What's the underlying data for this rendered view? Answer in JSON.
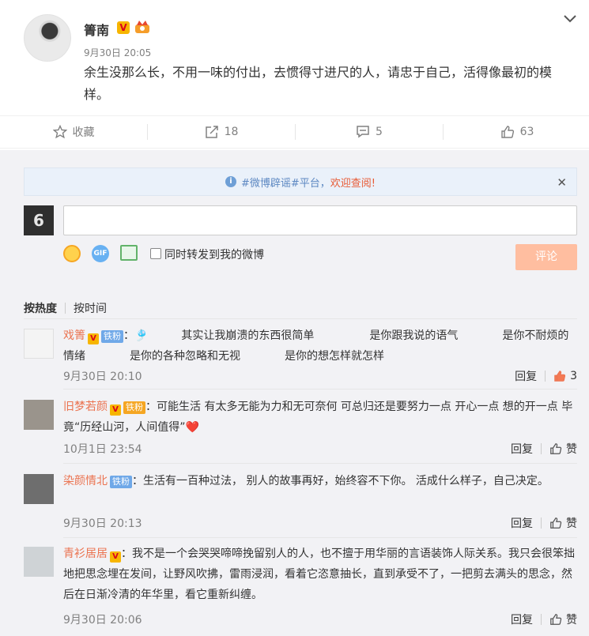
{
  "post": {
    "author": "箐南",
    "time": "9月30日 20:05",
    "text": "余生没那么长，不用一味的付出，去惯得寸进尺的人，请忠于自己，活得像最初的模样。"
  },
  "actions": {
    "favorite": "收藏",
    "repost": "18",
    "comment": "5",
    "like": "63"
  },
  "notice": {
    "prefix": "#微博辟谣#平台，",
    "highlight": "欢迎查阅!"
  },
  "composer": {
    "my_avatar_text": "6",
    "gif": "GIF",
    "repost_label": "同时转发到我的微博",
    "submit": "评论"
  },
  "sort": {
    "hot": "按热度",
    "time": "按时间"
  },
  "comments": [
    {
      "name": "戏箐",
      "badge": "铁粉",
      "text": "：🎐　　　其实让我崩溃的东西很简单　　　　　是你跟我说的语气　　　　是你不耐烦的情绪　　　　是你的各种忽略和无视　　　　是你的想怎样就怎样",
      "time": "9月30日 20:10",
      "reply": "回复",
      "like": "3"
    },
    {
      "name": "旧梦若颜",
      "badge": "铁粉",
      "text": "：可能生活 有太多无能为力和无可奈何 可总归还是要努力一点 开心一点 想的开一点 毕竟“历经山河，人间值得”❤️",
      "time": "10月1日 23:54",
      "reply": "回复",
      "like": "赞"
    },
    {
      "name": "染颜情北",
      "badge": "铁粉",
      "text": "：生活有一百种过法， 别人的故事再好，始终容不下你。 活成什么样子，自己决定。",
      "time": "9月30日 20:13",
      "reply": "回复",
      "like": "赞"
    },
    {
      "name": "青衫居居",
      "badge": "",
      "text": "：我不是一个会哭哭啼啼挽留别人的人，也不擅于用华丽的言语装饰人际关系。我只会很笨拙地把思念埋在发间，让野风吹拂，雷雨浸润，看着它恣意抽长，直到承受不了，一把剪去满头的思念，然后在日渐冷清的年华里，看它重新纠缠。",
      "time": "9月30日 20:06",
      "reply": "回复",
      "like": "赞"
    }
  ],
  "colors": {
    "accent": "#eb7350",
    "link": "#5d88c2",
    "submit_disabled": "#ffbea0"
  }
}
